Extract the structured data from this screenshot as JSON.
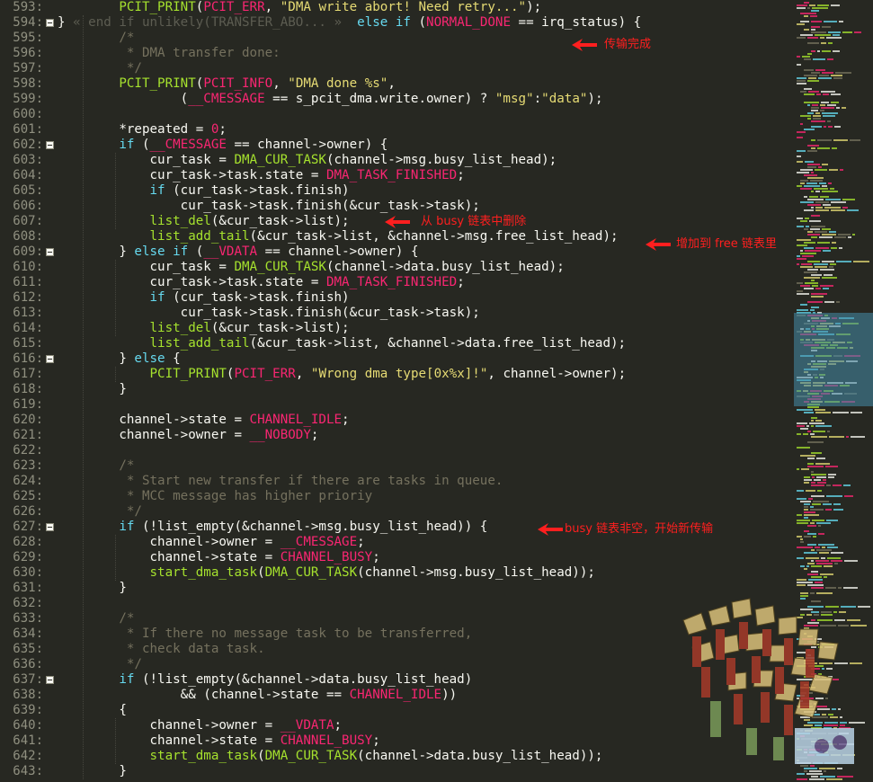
{
  "editor": {
    "line_numbers": [
      "593:",
      "594:",
      "595:",
      "596:",
      "597:",
      "598:",
      "599:",
      "600:",
      "601:",
      "602:",
      "603:",
      "604:",
      "605:",
      "606:",
      "607:",
      "608:",
      "609:",
      "610:",
      "611:",
      "612:",
      "613:",
      "614:",
      "615:",
      "616:",
      "617:",
      "618:",
      "619:",
      "620:",
      "621:",
      "622:",
      "623:",
      "624:",
      "625:",
      "626:",
      "627:",
      "628:",
      "629:",
      "630:",
      "631:",
      "632:",
      "633:",
      "634:",
      "635:",
      "636:",
      "637:",
      "638:",
      "639:",
      "640:",
      "641:",
      "642:",
      "643:"
    ],
    "fold_marker_lines": [
      "594",
      "602",
      "609",
      "616",
      "627",
      "637"
    ],
    "lines": [
      [
        [
          "p",
          "        "
        ],
        [
          "d",
          "PCIT_PRINT"
        ],
        [
          "p",
          "("
        ],
        [
          "n",
          "PCIT_ERR"
        ],
        [
          "p",
          ", "
        ],
        [
          "s",
          "\"DMA write abort! Need retry...\""
        ],
        [
          "p",
          ");"
        ]
      ],
      [
        [
          "p",
          "} "
        ],
        [
          "x",
          "« end if unlikely(TRANSFER_ABO... »"
        ],
        [
          "p",
          "  "
        ],
        [
          "k",
          "else if"
        ],
        [
          "p",
          " ("
        ],
        [
          "n",
          "NORMAL_DONE"
        ],
        [
          "p",
          " == irq_status) {"
        ]
      ],
      [
        [
          "p",
          "        "
        ],
        [
          "c",
          "/*"
        ]
      ],
      [
        [
          "p",
          "        "
        ],
        [
          "c",
          " * DMA transfer done:"
        ]
      ],
      [
        [
          "p",
          "        "
        ],
        [
          "c",
          " */"
        ]
      ],
      [
        [
          "p",
          "        "
        ],
        [
          "d",
          "PCIT_PRINT"
        ],
        [
          "p",
          "("
        ],
        [
          "n",
          "PCIT_INFO"
        ],
        [
          "p",
          ", "
        ],
        [
          "s",
          "\"DMA done %s\""
        ],
        [
          "p",
          ","
        ]
      ],
      [
        [
          "p",
          "                ("
        ],
        [
          "n",
          "__CMESSAGE"
        ],
        [
          "p",
          " == s_pcit_dma.write.owner) ? "
        ],
        [
          "s",
          "\"msg\""
        ],
        [
          "p",
          ":"
        ],
        [
          "s",
          "\"data\""
        ],
        [
          "p",
          ");"
        ]
      ],
      [
        [
          "p",
          ""
        ]
      ],
      [
        [
          "p",
          "        *repeated = "
        ],
        [
          "n",
          "0"
        ],
        [
          "p",
          ";"
        ]
      ],
      [
        [
          "p",
          "        "
        ],
        [
          "k",
          "if"
        ],
        [
          "p",
          " ("
        ],
        [
          "n",
          "__CMESSAGE"
        ],
        [
          "p",
          " == channel->owner) {"
        ]
      ],
      [
        [
          "p",
          "            cur_task = "
        ],
        [
          "d",
          "DMA_CUR_TASK"
        ],
        [
          "p",
          "(channel->msg.busy_list_head);"
        ]
      ],
      [
        [
          "p",
          "            cur_task->task.state = "
        ],
        [
          "n",
          "DMA_TASK_FINISHED"
        ],
        [
          "p",
          ";"
        ]
      ],
      [
        [
          "p",
          "            "
        ],
        [
          "k",
          "if"
        ],
        [
          "p",
          " (cur_task->task.finish)"
        ]
      ],
      [
        [
          "p",
          "                cur_task->task.finish(&cur_task->task);"
        ]
      ],
      [
        [
          "p",
          "            "
        ],
        [
          "d",
          "list_del"
        ],
        [
          "p",
          "(&cur_task->list);"
        ]
      ],
      [
        [
          "p",
          "            "
        ],
        [
          "d",
          "list_add_tail"
        ],
        [
          "p",
          "(&cur_task->list, &channel->msg.free_list_head);"
        ]
      ],
      [
        [
          "p",
          "        } "
        ],
        [
          "k",
          "else if"
        ],
        [
          "p",
          " ("
        ],
        [
          "n",
          "__VDATA"
        ],
        [
          "p",
          " == channel->owner) {"
        ]
      ],
      [
        [
          "p",
          "            cur_task = "
        ],
        [
          "d",
          "DMA_CUR_TASK"
        ],
        [
          "p",
          "(channel->data.busy_list_head);"
        ]
      ],
      [
        [
          "p",
          "            cur_task->task.state = "
        ],
        [
          "n",
          "DMA_TASK_FINISHED"
        ],
        [
          "p",
          ";"
        ]
      ],
      [
        [
          "p",
          "            "
        ],
        [
          "k",
          "if"
        ],
        [
          "p",
          " (cur_task->task.finish)"
        ]
      ],
      [
        [
          "p",
          "                cur_task->task.finish(&cur_task->task);"
        ]
      ],
      [
        [
          "p",
          "            "
        ],
        [
          "d",
          "list_del"
        ],
        [
          "p",
          "(&cur_task->list);"
        ]
      ],
      [
        [
          "p",
          "            "
        ],
        [
          "d",
          "list_add_tail"
        ],
        [
          "p",
          "(&cur_task->list, &channel->data.free_list_head);"
        ]
      ],
      [
        [
          "p",
          "        } "
        ],
        [
          "k",
          "else"
        ],
        [
          "p",
          " {"
        ]
      ],
      [
        [
          "p",
          "            "
        ],
        [
          "d",
          "PCIT_PRINT"
        ],
        [
          "p",
          "("
        ],
        [
          "n",
          "PCIT_ERR"
        ],
        [
          "p",
          ", "
        ],
        [
          "s",
          "\"Wrong dma type[0x%x]!\""
        ],
        [
          "p",
          ", channel->owner);"
        ]
      ],
      [
        [
          "p",
          "        }"
        ]
      ],
      [
        [
          "p",
          ""
        ]
      ],
      [
        [
          "p",
          "        channel->state = "
        ],
        [
          "n",
          "CHANNEL_IDLE"
        ],
        [
          "p",
          ";"
        ]
      ],
      [
        [
          "p",
          "        channel->owner = "
        ],
        [
          "n",
          "__NOBODY"
        ],
        [
          "p",
          ";"
        ]
      ],
      [
        [
          "p",
          ""
        ]
      ],
      [
        [
          "p",
          "        "
        ],
        [
          "c",
          "/*"
        ]
      ],
      [
        [
          "p",
          "        "
        ],
        [
          "c",
          " * Start new transfer if there are tasks in queue."
        ]
      ],
      [
        [
          "p",
          "        "
        ],
        [
          "c",
          " * MCC message has higher prioriy"
        ]
      ],
      [
        [
          "p",
          "        "
        ],
        [
          "c",
          " */"
        ]
      ],
      [
        [
          "p",
          "        "
        ],
        [
          "k",
          "if"
        ],
        [
          "p",
          " (!list_empty(&channel->msg.busy_list_head)) {"
        ]
      ],
      [
        [
          "p",
          "            channel->owner = "
        ],
        [
          "n",
          "__CMESSAGE"
        ],
        [
          "p",
          ";"
        ]
      ],
      [
        [
          "p",
          "            channel->state = "
        ],
        [
          "n",
          "CHANNEL_BUSY"
        ],
        [
          "p",
          ";"
        ]
      ],
      [
        [
          "p",
          "            "
        ],
        [
          "d",
          "start_dma_task"
        ],
        [
          "p",
          "("
        ],
        [
          "d",
          "DMA_CUR_TASK"
        ],
        [
          "p",
          "(channel->msg.busy_list_head));"
        ]
      ],
      [
        [
          "p",
          "        }"
        ]
      ],
      [
        [
          "p",
          ""
        ]
      ],
      [
        [
          "p",
          "        "
        ],
        [
          "c",
          "/*"
        ]
      ],
      [
        [
          "p",
          "        "
        ],
        [
          "c",
          " * If there no message task to be transferred,"
        ]
      ],
      [
        [
          "p",
          "        "
        ],
        [
          "c",
          " * check data task."
        ]
      ],
      [
        [
          "p",
          "        "
        ],
        [
          "c",
          " */"
        ]
      ],
      [
        [
          "p",
          "        "
        ],
        [
          "k",
          "if"
        ],
        [
          "p",
          " (!list_empty(&channel->data.busy_list_head)"
        ]
      ],
      [
        [
          "p",
          "                && (channel->state == "
        ],
        [
          "n",
          "CHANNEL_IDLE"
        ],
        [
          "p",
          "))"
        ]
      ],
      [
        [
          "p",
          "        {"
        ]
      ],
      [
        [
          "p",
          "            channel->owner = "
        ],
        [
          "n",
          "__VDATA"
        ],
        [
          "p",
          ";"
        ]
      ],
      [
        [
          "p",
          "            channel->state = "
        ],
        [
          "n",
          "CHANNEL_BUSY"
        ],
        [
          "p",
          ";"
        ]
      ],
      [
        [
          "p",
          "            "
        ],
        [
          "d",
          "start_dma_task"
        ],
        [
          "p",
          "("
        ],
        [
          "d",
          "DMA_CUR_TASK"
        ],
        [
          "p",
          "(channel->data.busy_list_head));"
        ]
      ],
      [
        [
          "p",
          "        }"
        ]
      ]
    ]
  },
  "annotations": [
    {
      "text": "传输完成",
      "line": "594"
    },
    {
      "text": "从  busy 链表中删除",
      "line": "607"
    },
    {
      "text": "增加到  free 链表里",
      "line": "608"
    },
    {
      "text": "busy 链表非空，开始新传输",
      "line": "627"
    }
  ],
  "colors": {
    "background": "#272822",
    "keyword": "#66d9ef",
    "constant": "#f92672",
    "string": "#e6db74",
    "comment": "#75715e",
    "function": "#a6e22e",
    "annotation": "#ff1f1f",
    "minimap_viewport": "#3c7f9c"
  },
  "watermark": {
    "description_icon": "stacked-figures-logo-icon"
  }
}
